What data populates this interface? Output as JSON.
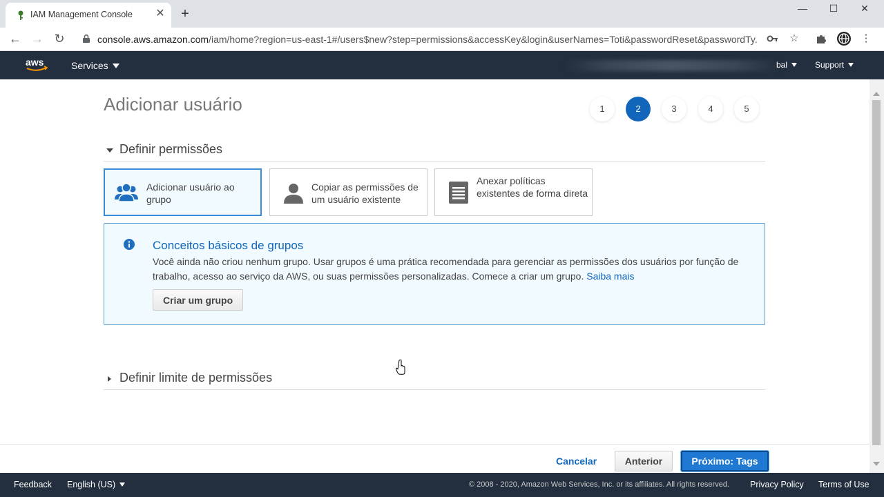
{
  "browser": {
    "tab_title": "IAM Management Console",
    "tab_close": "✕",
    "new_tab": "+",
    "url_host": "console.aws.amazon.com",
    "url_path": "/iam/home?region=us-east-1#/users$new?step=permissions&accessKey&login&userNames=Toti&passwordReset&passwordTy...",
    "window_controls": [
      "—",
      "☐",
      "✕"
    ]
  },
  "aws_nav": {
    "services_label": "Services",
    "account_tail": "bal",
    "support_label": "Support"
  },
  "page": {
    "title": "Adicionar usuário",
    "steps": [
      "1",
      "2",
      "3",
      "4",
      "5"
    ],
    "active_step": 2
  },
  "permissions": {
    "section_title": "Definir permissões",
    "options": [
      {
        "label": "Adicionar usuário ao grupo",
        "selected": true,
        "icon": "group-icon"
      },
      {
        "label": "Copiar as permissões de um usuário existente",
        "selected": false,
        "icon": "user-icon"
      },
      {
        "label": "Anexar políticas existentes de forma direta",
        "selected": false,
        "icon": "document-icon"
      }
    ]
  },
  "info": {
    "title": "Conceitos básicos de grupos",
    "text": "Você ainda não criou nenhum grupo. Usar grupos é uma prática recomendada para gerenciar as permissões dos usuários por função de trabalho, acesso ao serviço da AWS, ou suas permissões personalizadas. Comece a criar um grupo.",
    "learn_more": "Saiba mais",
    "create_group_button": "Criar um grupo"
  },
  "boundary": {
    "section_title": "Definir limite de permissões"
  },
  "actions": {
    "cancel": "Cancelar",
    "previous": "Anterior",
    "next": "Próximo: Tags"
  },
  "footer": {
    "feedback": "Feedback",
    "language": "English (US)",
    "copyright": "© 2008 - 2020, Amazon Web Services, Inc. or its affiliates. All rights reserved.",
    "privacy": "Privacy Policy",
    "terms": "Terms of Use"
  },
  "colors": {
    "aws_nav": "#232f3e",
    "accent_blue": "#1166bb",
    "info_bg": "#f1faff",
    "primary_button": "#1f78d1"
  }
}
